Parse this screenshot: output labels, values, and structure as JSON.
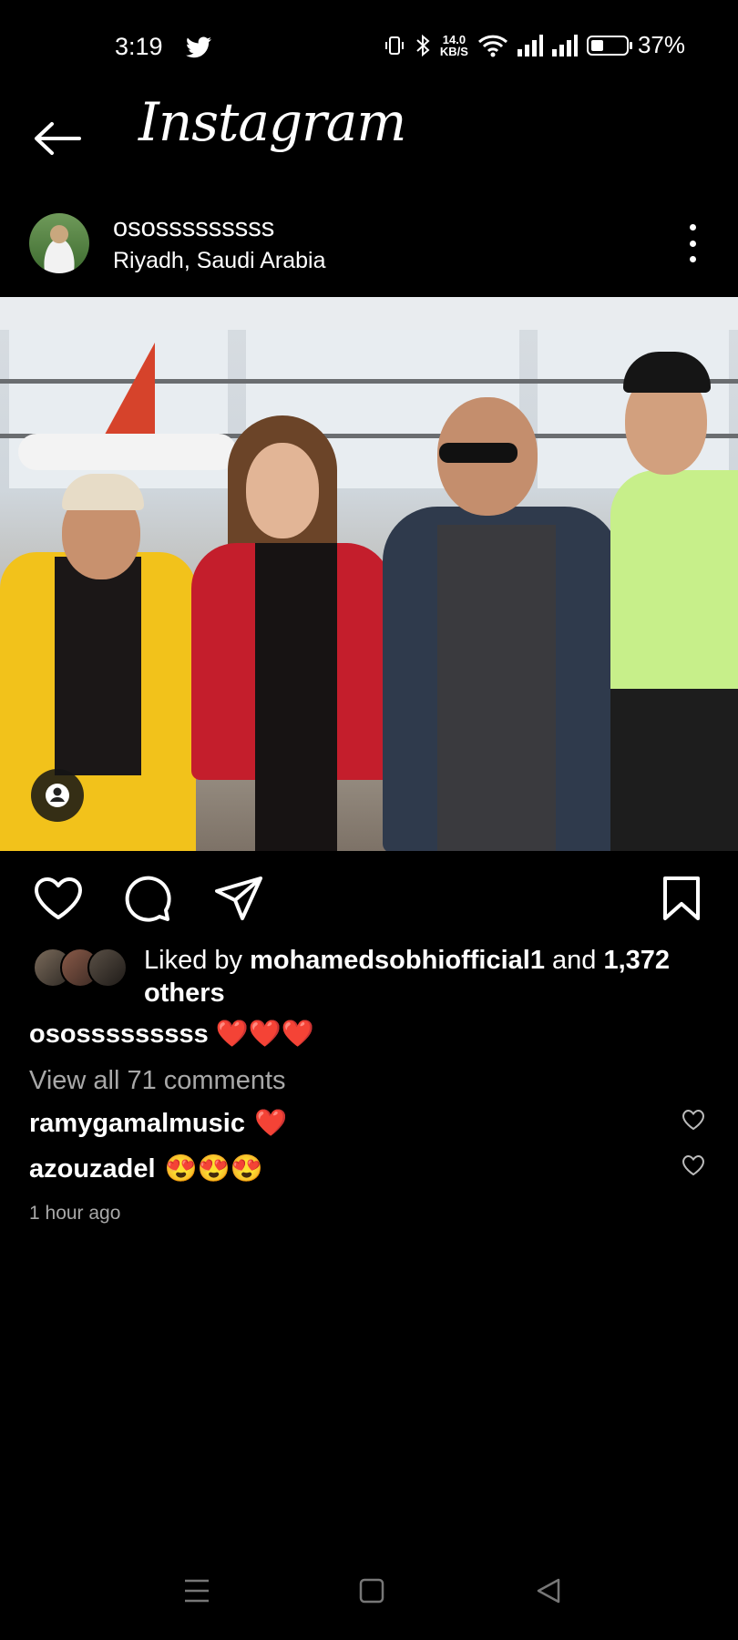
{
  "status_bar": {
    "time": "3:19",
    "net_speed_value": "14.0",
    "net_speed_unit": "KB/S",
    "battery": "37%",
    "battery_level": 0.37,
    "icons": [
      "twitter-icon",
      "vibrate-icon",
      "bluetooth-icon",
      "wifi-icon",
      "signal-icon",
      "battery-icon"
    ]
  },
  "header": {
    "title": "Instagram",
    "back_icon": "back-arrow-icon"
  },
  "post": {
    "username": "ososssssssss",
    "location": "Riyadh, Saudi Arabia",
    "photo_subject": "photo",
    "actions": [
      "like-icon",
      "comment-icon",
      "share-icon",
      "save-icon"
    ],
    "likes": {
      "prefix": "Liked by",
      "user": "mohamedsobhiofficial1",
      "connector": "and",
      "count_text": "1,372 others"
    },
    "caption": {
      "username": "ososssssssss",
      "text": "❤️❤️❤️"
    },
    "view_all_comments": "View all 71 comments",
    "comments": [
      {
        "username": "ramygamalmusic",
        "text": "❤️"
      },
      {
        "username": "azouzadel",
        "text": "😍😍😍"
      }
    ],
    "timestamp": "1 hour ago"
  },
  "nav_bar": {
    "icons": [
      "menu-icon",
      "home-icon",
      "back-icon"
    ]
  },
  "colors": {
    "background": "#000000",
    "text": "#ffffff",
    "muted": "#a8a8a8",
    "heart": "#e0283a"
  }
}
